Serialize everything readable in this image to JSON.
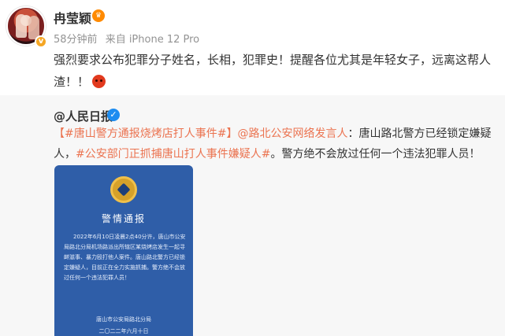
{
  "post": {
    "username": "冉莹颖",
    "time": "58分钟前",
    "source": "来自 iPhone 12 Pro",
    "text": "强烈要求公布犯罪分子姓名，长相，犯罪史！提醒各位尤其是年轻女子，远离这帮人渣！！"
  },
  "repost": {
    "author": "人民日报",
    "hashtag1": "【#唐山警方通报烧烤店打人事件#】",
    "mention": "@路北公安网络发言人",
    "text1": "：唐山路北警方已经锁定嫌疑人，",
    "hashtag2": "#公安部门正抓捕唐山打人事件嫌疑人#",
    "text2": "。警方绝不会放过任何一个违法犯罪人员！"
  },
  "notice": {
    "title": "警情通报",
    "body": "2022年6月10日凌晨2点40分许，唐山市公安局路北分局机场路派出所辖区某烧烤店发生一起寻衅滋事、暴力殴打他人案件。唐山路北警方已经锁定嫌疑人，目前正在全力实施抓捕。警方绝不会放过任何一个违法犯罪人员！",
    "signature": "唐山市公安局路北分局",
    "date": "二〇二二年六月十日"
  },
  "colors": {
    "link": "#eb7350",
    "notice_bg": "#2f5ea8",
    "verified_blue": "#1d8cf0"
  }
}
